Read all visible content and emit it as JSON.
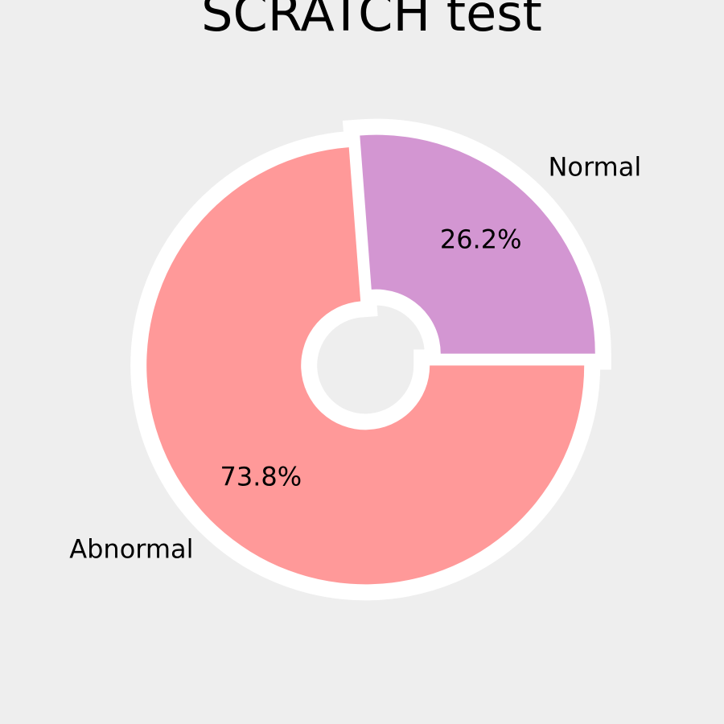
{
  "chart_data": {
    "type": "pie",
    "title": "SCRATCH test",
    "donut": true,
    "categories": [
      "Normal",
      "Abnormal"
    ],
    "values": [
      26.2,
      73.8
    ],
    "value_labels": [
      "26.2%",
      "73.8%"
    ],
    "colors": [
      "#d396d2",
      "#ff9999"
    ],
    "start_angle_deg": 0,
    "direction": "counterclockwise",
    "exploded": true,
    "wedge_edge_color": "#ffffff",
    "background": "#eeeeee",
    "legend": "none"
  }
}
